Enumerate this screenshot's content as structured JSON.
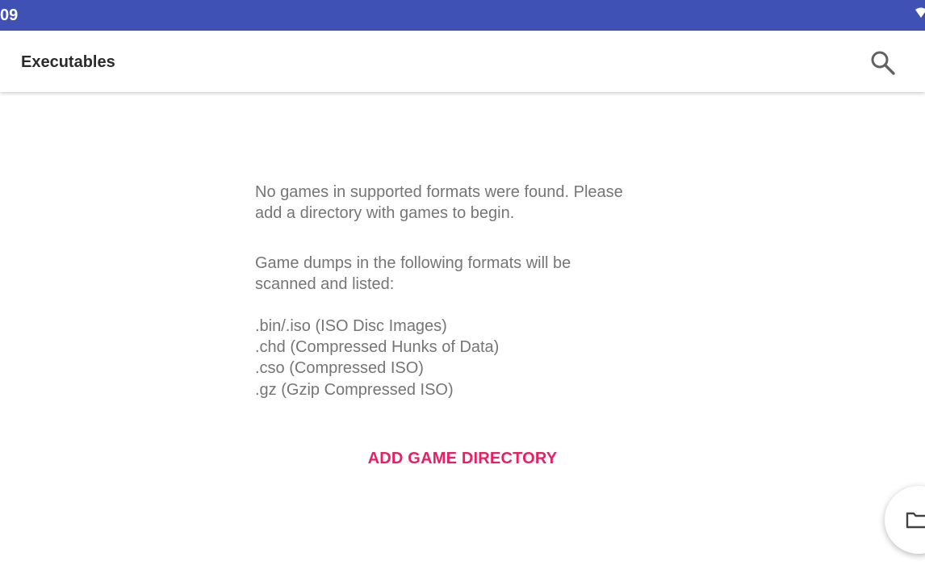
{
  "status_bar": {
    "time_fragment": "09",
    "color": "#3f51b5",
    "wifi_icon": "wifi-icon"
  },
  "app_bar": {
    "title": "Executables",
    "search_icon": "search-icon"
  },
  "empty_state": {
    "no_games_message": "No games in supported formats were found. Please\nadd a directory with games to begin.",
    "formats_intro": "Game dumps in the following formats will be\nscanned and listed:",
    "formats": [
      ".bin/.iso (ISO Disc Images)",
      ".chd (Compressed Hunks of Data)",
      ".cso (Compressed ISO)",
      ".gz (Gzip Compressed ISO)"
    ],
    "add_button_label": "ADD GAME DIRECTORY",
    "accent_color": "#e91e63"
  },
  "fab": {
    "icon": "folder-icon"
  }
}
